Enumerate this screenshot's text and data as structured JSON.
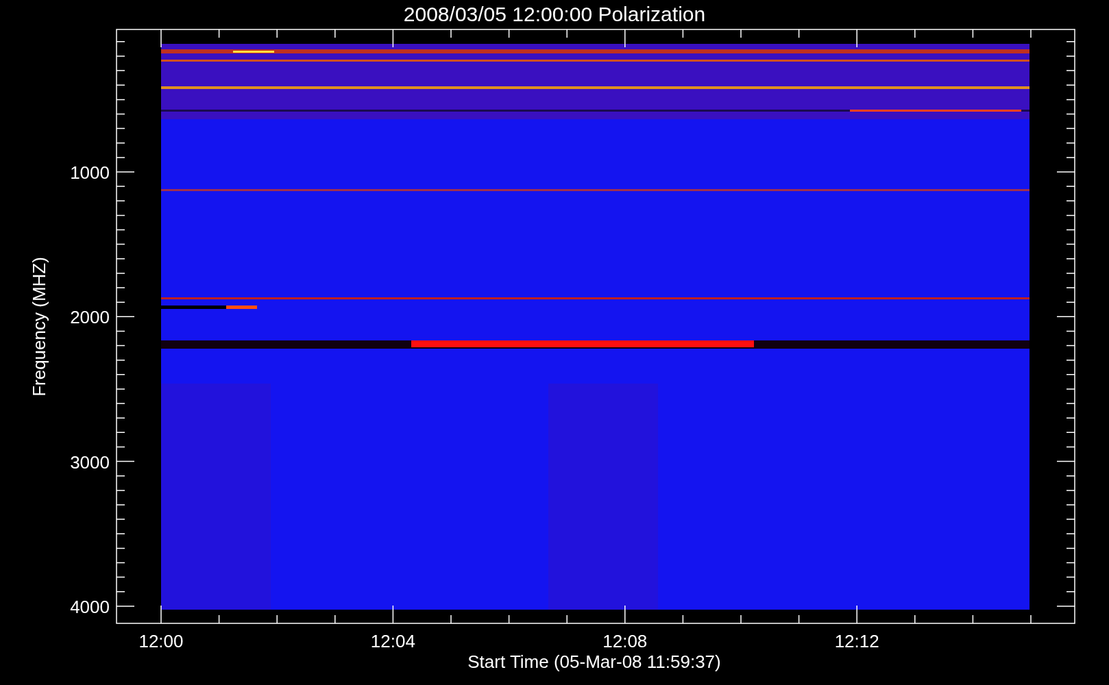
{
  "title": "2008/03/05 12:00:00 Polarization",
  "y_axis": {
    "label": "Frequency (MHZ)",
    "ticks": [
      "1000",
      "2000",
      "3000",
      "4000"
    ]
  },
  "x_axis": {
    "label": "Start Time (05-Mar-08 11:59:37)",
    "ticks": [
      "12:00",
      "12:04",
      "12:08",
      "12:12"
    ]
  }
}
